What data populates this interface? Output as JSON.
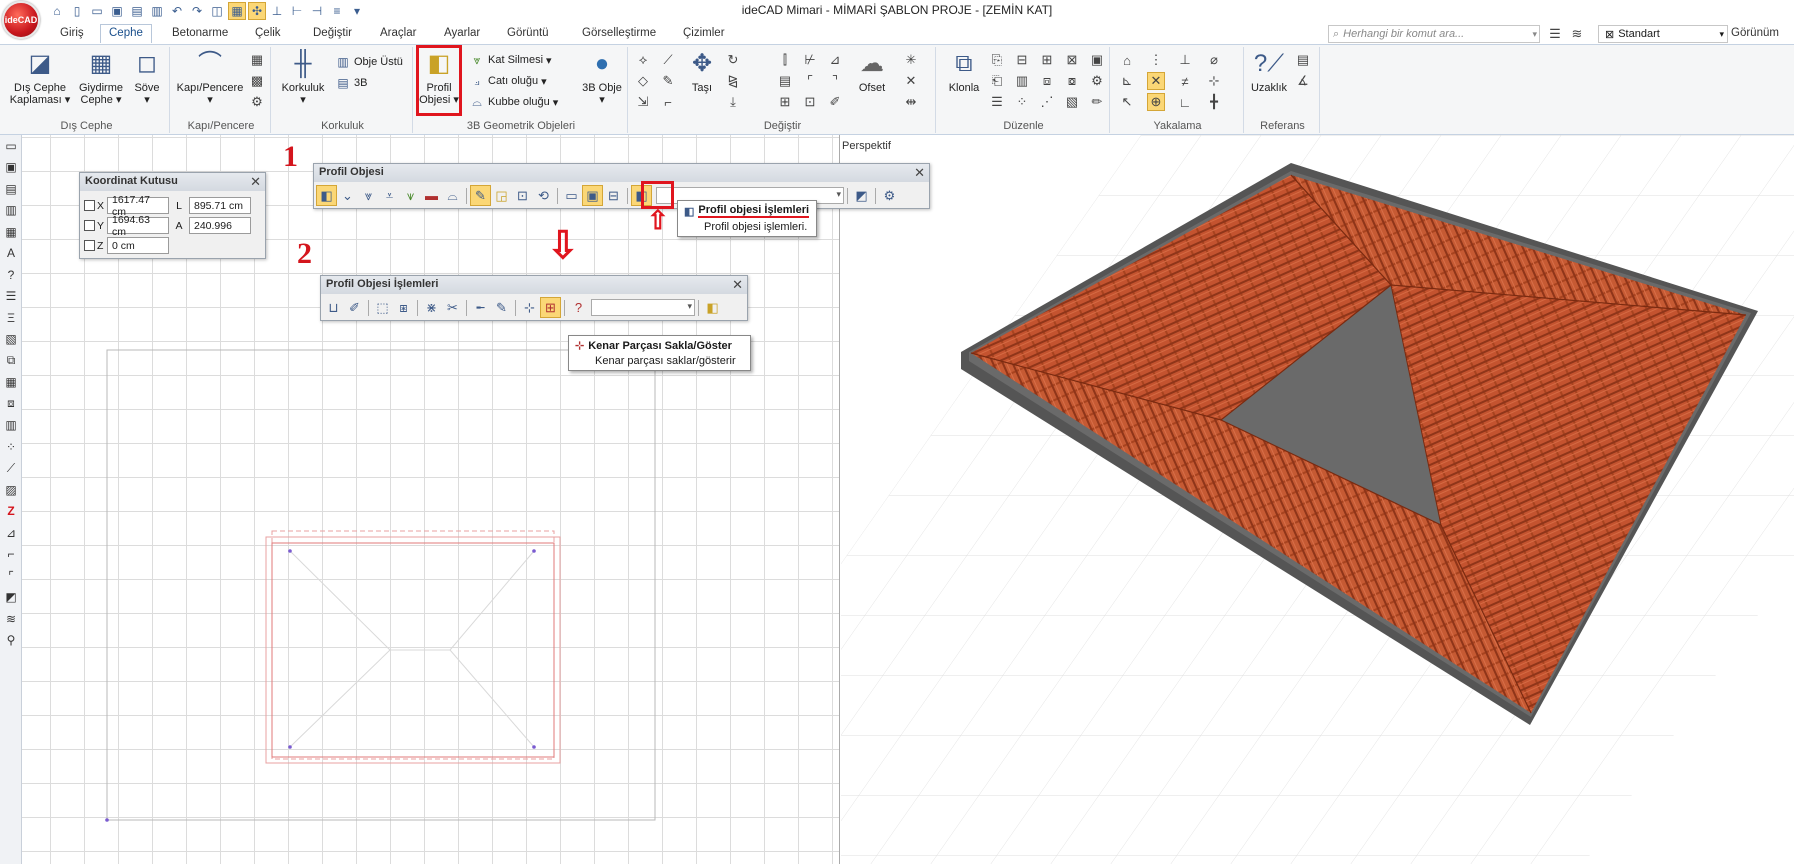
{
  "titlebar": {
    "app_logo": "ideCAD",
    "title": "ideCAD Mimari - MİMARİ ŞABLON PROJE - [ZEMİN KAT]"
  },
  "menu": {
    "tabs": [
      "Giriş",
      "Cephe",
      "Betonarme",
      "Çelik",
      "Değiştir",
      "Araçlar",
      "Ayarlar",
      "Görüntü",
      "Görselleştirme",
      "Çizimler"
    ],
    "active_tab": "Cephe",
    "search_placeholder": "Herhangi bir komut ara...",
    "style_value": "Standart",
    "view_label": "Görünüm"
  },
  "ribbon": {
    "groups": {
      "dis_cephe": {
        "label": "Dış Cephe",
        "dis_cephe_kaplamasi": "Dış Cephe Kaplaması",
        "giydirme_cephe": "Giydirme Cephe",
        "sove": "Söve"
      },
      "kapi_pencere": {
        "label": "Kapı/Pencere",
        "kapi_pencere": "Kapı/Pencere"
      },
      "korkuluk": {
        "label": "Korkuluk",
        "korkuluk": "Korkuluk",
        "obje_ustu": "Obje Üstü",
        "uc_b": "3B"
      },
      "geometrik": {
        "label": "3B Geometrik Objeleri",
        "profil_objesi": "Profil Objesi",
        "kat_silmesi": "Kat Silmesi",
        "cati_olugu": "Catı oluğu",
        "kubbe_olugu": "Kubbe oluğu",
        "obje_3b": "3B Obje"
      },
      "degistir": {
        "label": "Değiştir",
        "tasi": "Taşı",
        "ofset": "Ofset"
      },
      "duzenle": {
        "label": "Düzenle",
        "klonla": "Klonla"
      },
      "yakalama": {
        "label": "Yakalama"
      },
      "referans": {
        "label": "Referans",
        "uzaklik": "Uzaklık"
      }
    }
  },
  "coord_box": {
    "title": "Koordinat Kutusu",
    "x_label": "X",
    "x_value": "1617.47 cm",
    "y_label": "Y",
    "y_value": "1694.63 cm",
    "z_label": "Z",
    "z_value": "0 cm",
    "l_label": "L",
    "l_value": "895.71 cm",
    "a_label": "A",
    "a_value": "240.996"
  },
  "profil_toolbar": {
    "title": "Profil Objesi",
    "step_number": "1",
    "tooltip_title": "Profil objesi İşlemleri",
    "tooltip_desc": "Profil objesi işlemleri."
  },
  "islemleri_toolbar": {
    "title": "Profil  Objesi İşlemleri",
    "step_number": "2",
    "tooltip_title": "Kenar Parçası Sakla/Göster",
    "tooltip_desc": "Kenar parçası saklar/gösterir"
  },
  "view3d": {
    "label": "Perspektif",
    "roof_color": "#c4532f",
    "edge_color": "#555555"
  },
  "colors": {
    "accent_red": "#e0151e",
    "highlight": "#fbd776",
    "tab_active_text": "#1a4f8c"
  }
}
